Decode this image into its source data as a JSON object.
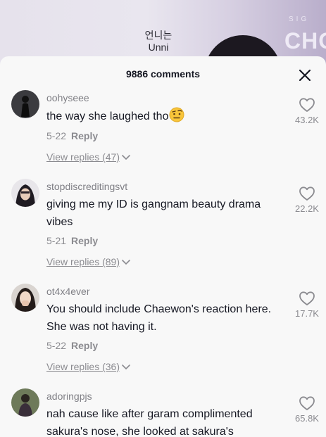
{
  "video": {
    "subtitle_korean": "언니는",
    "subtitle_english": "Unni",
    "logo_text": "CHO",
    "logo_small": "SIG"
  },
  "header": {
    "comment_count": "9886 comments"
  },
  "comments": [
    {
      "username": "oohyseee",
      "text": "the way she laughed tho",
      "emoji": "raised-eyebrow-emoji",
      "date": "5-22",
      "reply_label": "Reply",
      "view_replies": "View replies (47)",
      "likes": "43.2K"
    },
    {
      "username": "stopdiscreditingsvt",
      "text": "giving me my ID is gangnam beauty drama vibes",
      "date": "5-21",
      "reply_label": "Reply",
      "view_replies": "View replies (89)",
      "likes": "22.2K"
    },
    {
      "username": "ot4x4ever",
      "text": "You should include Chaewon's reaction here. She was not having it.",
      "date": "5-22",
      "reply_label": "Reply",
      "view_replies": "View replies (36)",
      "likes": "17.7K"
    },
    {
      "username": "adoringpjs",
      "text": "nah cause like after garam complimented sakura's nose, she looked at sakura's",
      "likes": "65.8K"
    }
  ],
  "icons": {
    "close": "close-icon",
    "like": "heart-outline-icon",
    "expand": "chevron-down-icon"
  },
  "colors": {
    "sheet_background": "#f8f8f8",
    "primary_text": "#161823",
    "secondary_text": "#8b8b90"
  }
}
